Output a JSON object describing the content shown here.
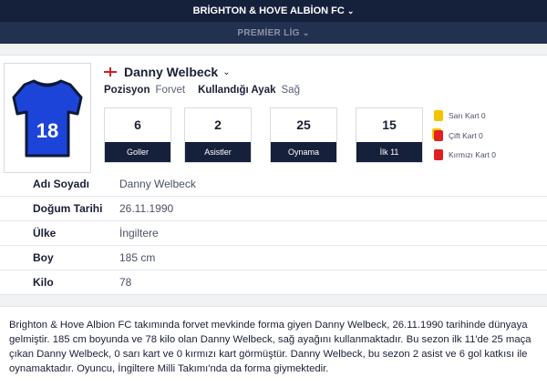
{
  "team": {
    "name": "BRİGHTON & HOVE ALBİON FC"
  },
  "league": {
    "name": "PREMİER LİG"
  },
  "player": {
    "name": "Danny Welbeck",
    "number": "18",
    "position_label": "Pozisyon",
    "position": "Forvet",
    "foot_label": "Kullandığı Ayak",
    "foot": "Sağ",
    "jersey_color": "#1d44d8"
  },
  "stats": [
    {
      "value": "6",
      "label": "Goller"
    },
    {
      "value": "2",
      "label": "Asistler"
    },
    {
      "value": "25",
      "label": "Oynama"
    },
    {
      "value": "15",
      "label": "İlk 11"
    }
  ],
  "cards": [
    {
      "label": "Sarı Kart 0",
      "color": "#f5c400"
    },
    {
      "label": "Çift Kart 0",
      "color": "#e02020"
    },
    {
      "label": "Kırmızı Kart 0",
      "color": "#e02020"
    }
  ],
  "info": [
    {
      "key": "Adı Soyadı",
      "value": "Danny Welbeck"
    },
    {
      "key": "Doğum Tarihi",
      "value": "26.11.1990"
    },
    {
      "key": "Ülke",
      "value": "İngiltere"
    },
    {
      "key": "Boy",
      "value": "185 cm"
    },
    {
      "key": "Kilo",
      "value": "78"
    }
  ],
  "description": "Brighton & Hove Albion FC takımında forvet mevkinde forma giyen Danny Welbeck, 26.11.1990 tarihinde dünyaya gelmiştir. 185 cm boyunda ve 78 kilo olan Danny Welbeck, sağ ayağını kullanmaktadır. Bu sezon ilk 11'de 25 maça çıkan Danny Welbeck, 0 sarı kart ve 0 kırmızı kart görmüştür. Danny Welbeck, bu sezon 2 asist ve 6 gol katkısı ile oynamaktadır. Oyuncu, İngiltere Milli Takımı'nda da forma giymektedir."
}
